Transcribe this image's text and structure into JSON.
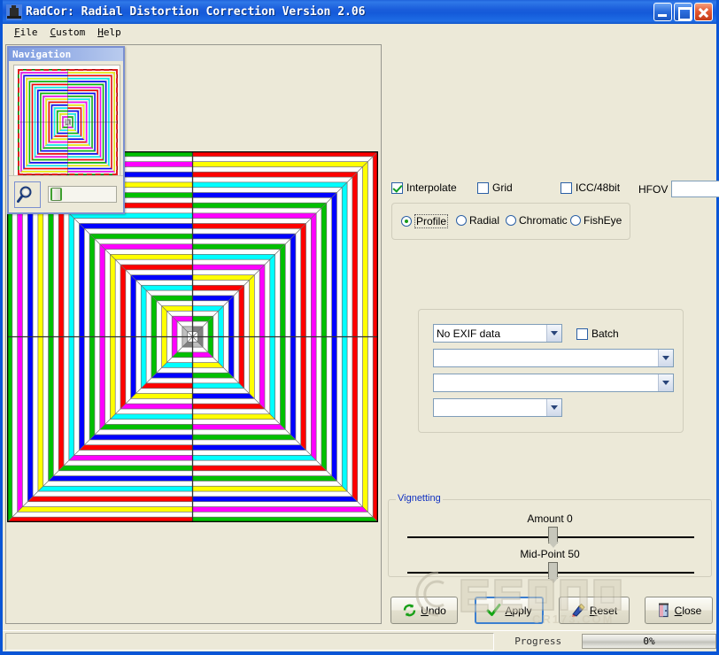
{
  "window": {
    "title": "RadCor: Radial Distortion Correction Version 2.06",
    "icon": "camera-icon",
    "buttons": {
      "minimize": "minimize-icon",
      "maximize": "maximize-icon",
      "close": "close-icon"
    }
  },
  "menubar": {
    "items": [
      {
        "label": "File",
        "accel": "F"
      },
      {
        "label": "Custom",
        "accel": "C"
      },
      {
        "label": "Help",
        "accel": "H"
      }
    ]
  },
  "navigation": {
    "title": "Navigation",
    "zoom_button": "magnifier-icon",
    "zoom_slider_value": 0
  },
  "options": {
    "interpolate": {
      "label": "Interpolate",
      "checked": true
    },
    "grid": {
      "label": "Grid",
      "checked": false
    },
    "icc": {
      "label": "ICC/48bit",
      "checked": false
    },
    "hfov": {
      "label": "HFOV",
      "value": "",
      "placeholder": ""
    }
  },
  "mode": {
    "selected": "Profile",
    "items": [
      {
        "label": "Profile",
        "selected": true
      },
      {
        "label": "Radial",
        "selected": false
      },
      {
        "label": "Chromatic",
        "selected": false
      },
      {
        "label": "FishEye",
        "selected": false
      }
    ]
  },
  "exif": {
    "combo_exif": {
      "value": "No EXIF data"
    },
    "combo_make": {
      "value": ""
    },
    "combo_model": {
      "value": ""
    },
    "combo_lens": {
      "value": ""
    },
    "batch": {
      "label": "Batch",
      "checked": false
    }
  },
  "vignetting": {
    "legend": "Vignetting",
    "amount": {
      "label": "Amount 0",
      "value": 0,
      "min": -100,
      "max": 100
    },
    "midpoint": {
      "label": "Mid-Point 50",
      "value": 50,
      "min": 0,
      "max": 100
    }
  },
  "actions": {
    "undo": {
      "label": "Undo",
      "accel": "U",
      "icon": "refresh-icon",
      "default": false
    },
    "apply": {
      "label": "Apply",
      "accel": "A",
      "icon": "checkmark-icon",
      "default": true
    },
    "reset": {
      "label": "Reset",
      "accel": "R",
      "icon": "eraser-icon",
      "default": false
    },
    "close": {
      "label": "Close",
      "accel": "C",
      "icon": "door-icon",
      "default": false
    }
  },
  "statusbar": {
    "message": "",
    "progress_label": "Progress",
    "progress_text": "0%",
    "progress_value": 0
  },
  "watermark": {
    "text": "CR173.COM"
  },
  "colors": {
    "titlebar": "#1a5ddb",
    "face": "#ece9d8",
    "accent_blue": "#1030c0",
    "selection_red": "#e02020",
    "check_green": "#0f9c26"
  },
  "test_pattern": {
    "description": "Concentric square rings test chart with diagonal quadrant divisions and center crosshair",
    "rings": 36,
    "ring_colors": [
      "#00c000",
      "#ffffff",
      "#ff00ff",
      "#ffffff",
      "#0000ff",
      "#ffffff",
      "#ffff00",
      "#ffffff",
      "#00c000",
      "#ffffff",
      "#ff0000",
      "#ffffff",
      "#00ffff",
      "#ffffff",
      "#0000ff",
      "#ffffff",
      "#00c000",
      "#ffffff",
      "#ff00ff",
      "#ffffff",
      "#ffff00",
      "#ffffff",
      "#ff0000",
      "#ffffff",
      "#0000ff",
      "#ffffff",
      "#00ffff",
      "#ffffff",
      "#00c000",
      "#ffffff",
      "#ffff00",
      "#ffffff",
      "#ff00ff",
      "#ffffff",
      "#c0c0c0",
      "#ffffff"
    ],
    "opposite_colors": [
      "#ff0000",
      "#ffffff",
      "#ffff00",
      "#ffffff",
      "#ff0000",
      "#ffffff",
      "#00ffff",
      "#ffffff",
      "#0000ff",
      "#ffffff",
      "#00c000",
      "#ffffff",
      "#ff00ff",
      "#ffffff",
      "#ff0000",
      "#ffffff",
      "#0000ff",
      "#ffffff",
      "#00c000",
      "#ffffff",
      "#00ffff",
      "#ffffff",
      "#ff00ff",
      "#ffffff",
      "#ffff00",
      "#ffffff",
      "#ff0000",
      "#ffffff",
      "#0000ff",
      "#ffffff",
      "#00ffff",
      "#ffffff",
      "#00c000",
      "#ffffff",
      "#808080",
      "#ffffff"
    ]
  }
}
